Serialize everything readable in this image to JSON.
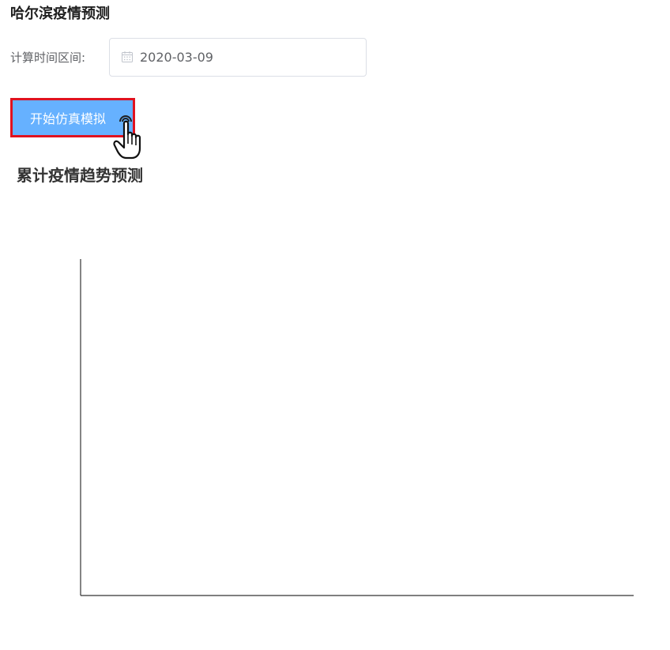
{
  "page": {
    "title": "哈尔滨疫情预测"
  },
  "form": {
    "time_range_label": "计算时间区间:",
    "date_value": "2020-03-09",
    "calendar_icon": "calendar-icon"
  },
  "actions": {
    "start_label": "开始仿真模拟",
    "highlight_color": "#e0121f",
    "button_color": "#66b1ff"
  },
  "chart": {
    "title": "累计疫情趋势预测"
  },
  "chart_data": {
    "type": "line",
    "title": "累计疫情趋势预测",
    "series": [],
    "grid": false,
    "xlabel": "",
    "ylabel": ""
  }
}
